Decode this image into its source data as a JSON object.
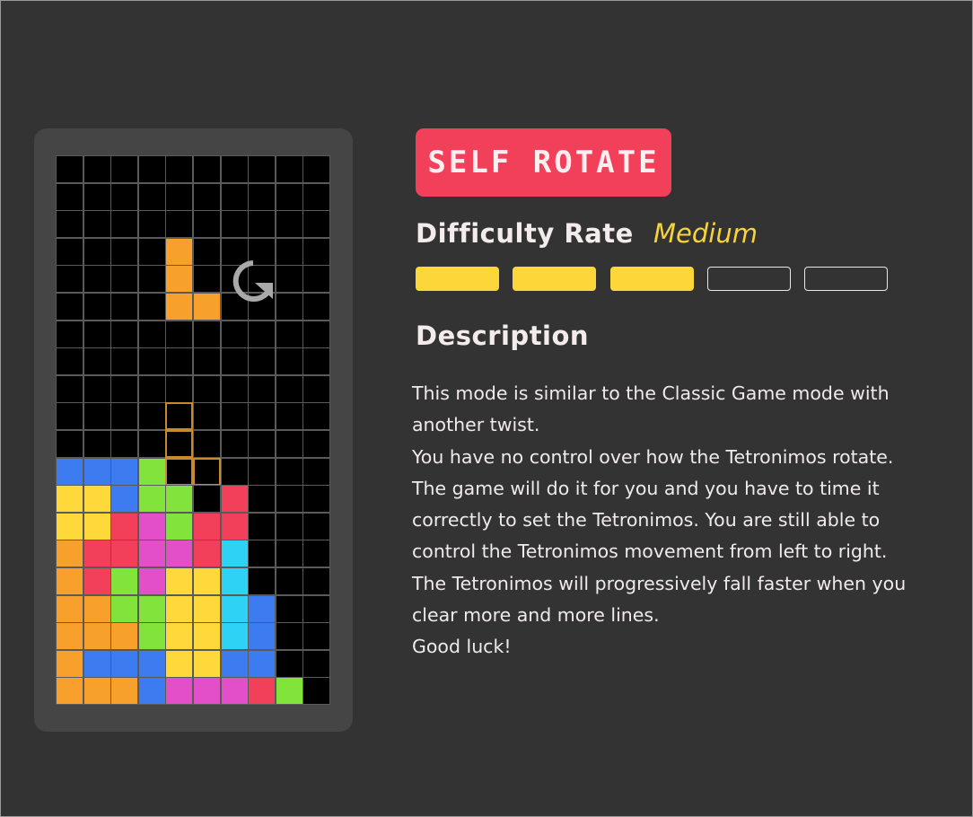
{
  "mode": {
    "label": "SELF ROTATE"
  },
  "difficulty": {
    "label": "Difficulty Rate",
    "value": "Medium",
    "level": 3,
    "max": 5
  },
  "description": {
    "title": "Description",
    "paragraphs": [
      "This mode is similar to the Classic Game mode with another twist.",
      "You have no control over how the Tetronimos rotate. The game will do it for you and you have to time it correctly to set the Tetronimos. You are still able to control the Tetronimos movement from left to right.",
      "The Tetronimos will progressively fall faster when you clear more and more lines.",
      "Good luck!"
    ]
  },
  "colors": {
    "O": "#ffd83a",
    "R": "#f2405a",
    "P": "#e24fc9",
    "G": "#82e33a",
    "C": "#2ed2f5",
    "B": "#3d7cf0",
    "A": "#f8a02c"
  },
  "board": {
    "cols": 10,
    "rows": [
      "..........",
      "..........",
      "..........",
      "..........",
      "..........",
      "..........",
      "..........",
      "..........",
      "..........",
      "..........",
      "..........",
      "BBBG......",
      "OOBGG.R...",
      "OORPGRR...",
      "ARRPPRC...",
      "ARGPOOC...",
      "AAGGOOCB..",
      "AAAGOOCB..",
      "ABBBOOBB..",
      "AAABPPPRG."
    ],
    "active_piece": {
      "color": "A",
      "cells": [
        [
          4,
          3
        ],
        [
          4,
          4
        ],
        [
          4,
          5
        ],
        [
          5,
          5
        ]
      ]
    },
    "ghost_piece": {
      "cells": [
        [
          4,
          9
        ],
        [
          4,
          10
        ],
        [
          4,
          11
        ],
        [
          5,
          11
        ]
      ]
    }
  }
}
